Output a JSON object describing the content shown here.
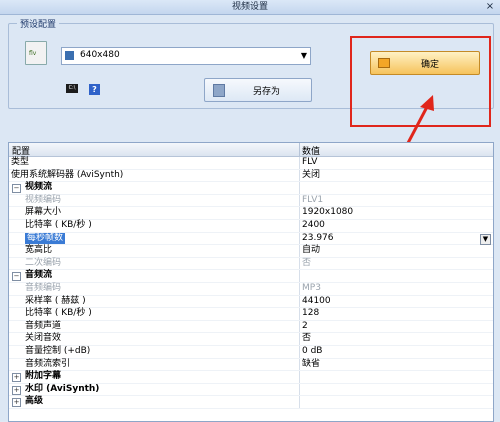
{
  "window": {
    "title": "视频设置",
    "close_glyph": "×"
  },
  "preset": {
    "group_label": "预设配置",
    "selected": "640x480",
    "save_as_label": "另存为"
  },
  "ok_label": "确定",
  "grid": {
    "header_name": "配置",
    "header_value": "数值",
    "rows": [
      {
        "name": "类型",
        "value": "FLV",
        "kind": "top"
      },
      {
        "name": "使用系统解码器 (AviSynth)",
        "value": "关闭",
        "kind": "top"
      },
      {
        "name": "视频流",
        "value": "",
        "kind": "group",
        "expander": "⊟"
      },
      {
        "name": "视频编码",
        "value": "FLV1",
        "kind": "child",
        "disabled": true
      },
      {
        "name": "屏幕大小",
        "value": "1920x1080",
        "kind": "child"
      },
      {
        "name": "比特率 ( KB/秒 )",
        "value": "2400",
        "kind": "child"
      },
      {
        "name": "每秒帧数",
        "value": "23.976",
        "kind": "child",
        "selected": true,
        "dropdown": true
      },
      {
        "name": "宽高比",
        "value": "自动",
        "kind": "child"
      },
      {
        "name": "二次编码",
        "value": "否",
        "kind": "child",
        "disabled": true
      },
      {
        "name": "音频流",
        "value": "",
        "kind": "group",
        "expander": "⊟"
      },
      {
        "name": "音频编码",
        "value": "MP3",
        "kind": "child",
        "disabled": true
      },
      {
        "name": "采样率 ( 赫兹 )",
        "value": "44100",
        "kind": "child"
      },
      {
        "name": "比特率 ( KB/秒 )",
        "value": "128",
        "kind": "child"
      },
      {
        "name": "音频声道",
        "value": "2",
        "kind": "child"
      },
      {
        "name": "关闭音效",
        "value": "否",
        "kind": "child"
      },
      {
        "name": "音量控制 (+dB)",
        "value": "0 dB",
        "kind": "child"
      },
      {
        "name": "音频流索引",
        "value": "缺省",
        "kind": "child"
      },
      {
        "name": "附加字幕",
        "value": "",
        "kind": "group",
        "expander": "⊞"
      },
      {
        "name": "水印 (AviSynth)",
        "value": "",
        "kind": "group",
        "expander": "⊞"
      },
      {
        "name": "高级",
        "value": "",
        "kind": "group",
        "expander": "⊞"
      }
    ]
  },
  "colors": {
    "highlight": "#e0261b",
    "selection": "#3a7bd5",
    "window_bg": "#dce7f4"
  },
  "icons": [
    "close-icon",
    "flv-file-icon",
    "monitor-icon",
    "chevron-down-icon",
    "cmd-icon",
    "help-icon",
    "save-icon",
    "ok-arrow-icon"
  ]
}
